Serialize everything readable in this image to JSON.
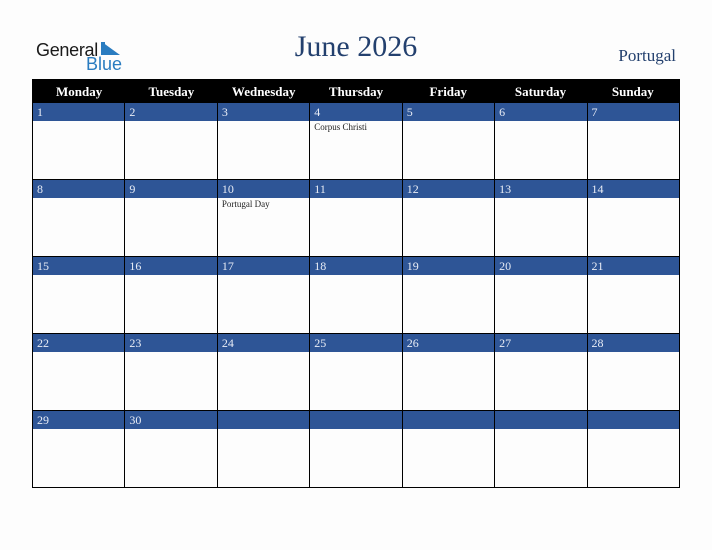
{
  "logo": {
    "word1": "General",
    "word2": "Blue"
  },
  "title": "June 2026",
  "country": "Portugal",
  "colors": {
    "band": "#2e5596",
    "title": "#23406e",
    "header_bg": "#000000"
  },
  "weekdays": [
    "Monday",
    "Tuesday",
    "Wednesday",
    "Thursday",
    "Friday",
    "Saturday",
    "Sunday"
  ],
  "weeks": [
    [
      {
        "day": "1",
        "holiday": ""
      },
      {
        "day": "2",
        "holiday": ""
      },
      {
        "day": "3",
        "holiday": ""
      },
      {
        "day": "4",
        "holiday": "Corpus Christi"
      },
      {
        "day": "5",
        "holiday": ""
      },
      {
        "day": "6",
        "holiday": ""
      },
      {
        "day": "7",
        "holiday": ""
      }
    ],
    [
      {
        "day": "8",
        "holiday": ""
      },
      {
        "day": "9",
        "holiday": ""
      },
      {
        "day": "10",
        "holiday": "Portugal Day"
      },
      {
        "day": "11",
        "holiday": ""
      },
      {
        "day": "12",
        "holiday": ""
      },
      {
        "day": "13",
        "holiday": ""
      },
      {
        "day": "14",
        "holiday": ""
      }
    ],
    [
      {
        "day": "15",
        "holiday": ""
      },
      {
        "day": "16",
        "holiday": ""
      },
      {
        "day": "17",
        "holiday": ""
      },
      {
        "day": "18",
        "holiday": ""
      },
      {
        "day": "19",
        "holiday": ""
      },
      {
        "day": "20",
        "holiday": ""
      },
      {
        "day": "21",
        "holiday": ""
      }
    ],
    [
      {
        "day": "22",
        "holiday": ""
      },
      {
        "day": "23",
        "holiday": ""
      },
      {
        "day": "24",
        "holiday": ""
      },
      {
        "day": "25",
        "holiday": ""
      },
      {
        "day": "26",
        "holiday": ""
      },
      {
        "day": "27",
        "holiday": ""
      },
      {
        "day": "28",
        "holiday": ""
      }
    ],
    [
      {
        "day": "29",
        "holiday": ""
      },
      {
        "day": "30",
        "holiday": ""
      },
      {
        "day": "",
        "holiday": ""
      },
      {
        "day": "",
        "holiday": ""
      },
      {
        "day": "",
        "holiday": ""
      },
      {
        "day": "",
        "holiday": ""
      },
      {
        "day": "",
        "holiday": ""
      }
    ]
  ]
}
